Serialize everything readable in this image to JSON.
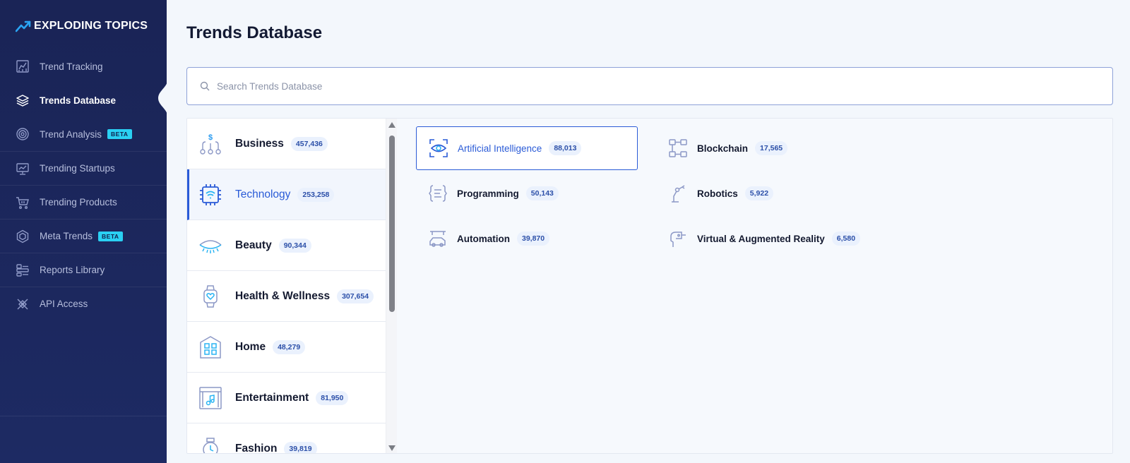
{
  "app": {
    "logo_text": "EXPLODING TOPICS"
  },
  "sidebar": {
    "items": [
      {
        "label": "Trend Tracking",
        "icon": "trend-tracking-icon"
      },
      {
        "label": "Trends Database",
        "icon": "layers-icon"
      },
      {
        "label": "Trend Analysis",
        "icon": "target-icon",
        "badge": "BETA"
      },
      {
        "label": "Trending Startups",
        "icon": "presentation-chart-icon"
      },
      {
        "label": "Trending Products",
        "icon": "cart-icon"
      },
      {
        "label": "Meta Trends",
        "icon": "hexagon-icon",
        "badge": "BETA"
      },
      {
        "label": "Reports Library",
        "icon": "reports-icon"
      },
      {
        "label": "API Access",
        "icon": "api-icon"
      }
    ]
  },
  "main": {
    "title": "Trends Database",
    "search": {
      "placeholder": "Search Trends Database"
    },
    "categories": [
      {
        "name": "Business",
        "count": "457,436",
        "icon": "business-icon"
      },
      {
        "name": "Technology",
        "count": "253,258",
        "icon": "chip-icon"
      },
      {
        "name": "Beauty",
        "count": "90,344",
        "icon": "eyelash-icon"
      },
      {
        "name": "Health & Wellness",
        "count": "307,654",
        "icon": "smartwatch-heart-icon"
      },
      {
        "name": "Home",
        "count": "48,279",
        "icon": "building-icon"
      },
      {
        "name": "Entertainment",
        "count": "81,950",
        "icon": "theater-icon"
      },
      {
        "name": "Fashion",
        "count": "39,819",
        "icon": "watch-icon"
      }
    ],
    "subcategories": [
      {
        "name": "Artificial Intelligence",
        "count": "88,013",
        "icon": "eye-scan-icon"
      },
      {
        "name": "Blockchain",
        "count": "17,565",
        "icon": "blockchain-icon"
      },
      {
        "name": "Programming",
        "count": "50,143",
        "icon": "code-brackets-icon"
      },
      {
        "name": "Robotics",
        "count": "5,922",
        "icon": "robot-arm-icon"
      },
      {
        "name": "Automation",
        "count": "39,870",
        "icon": "car-automation-icon"
      },
      {
        "name": "Virtual & Augmented Reality",
        "count": "6,580",
        "icon": "vr-headset-icon"
      }
    ]
  },
  "colors": {
    "accent": "#2a5bd7",
    "sidebar_bg": "#1a2456",
    "badge": "#2ad0f3"
  }
}
